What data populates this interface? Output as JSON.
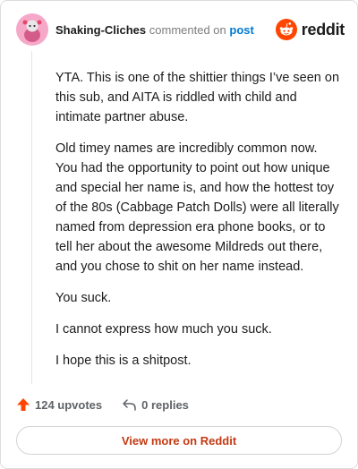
{
  "header": {
    "username": "Shaking-Cliches",
    "action_text": "commented on",
    "target_link": "post",
    "brand": "reddit"
  },
  "comment": {
    "paragraphs": [
      "YTA. This is one of the shittier things I’ve seen on this sub, and AITA is riddled with child and intimate partner abuse.",
      "Old timey names are incredibly common now. You had the opportunity to point out how unique and special her name is, and how the hottest toy of the 80s (Cabbage Patch Dolls) were all literally named from depression era phone books, or to tell her about the awesome Mildreds out there, and you chose to shit on her name instead.",
      "You suck.",
      "I cannot express how much you suck.",
      "I hope this is a shitpost."
    ]
  },
  "footer": {
    "upvotes": "124 upvotes",
    "replies": "0 replies",
    "view_more": "View more on Reddit"
  },
  "colors": {
    "accent": "#ff4500",
    "link": "#0079d3",
    "view_more_text": "#c33a12",
    "avatar_bg": "#f6a8c9"
  },
  "icons": [
    "avatar-snoo",
    "reddit-logo-icon",
    "upvote-arrow-icon",
    "reply-icon"
  ]
}
